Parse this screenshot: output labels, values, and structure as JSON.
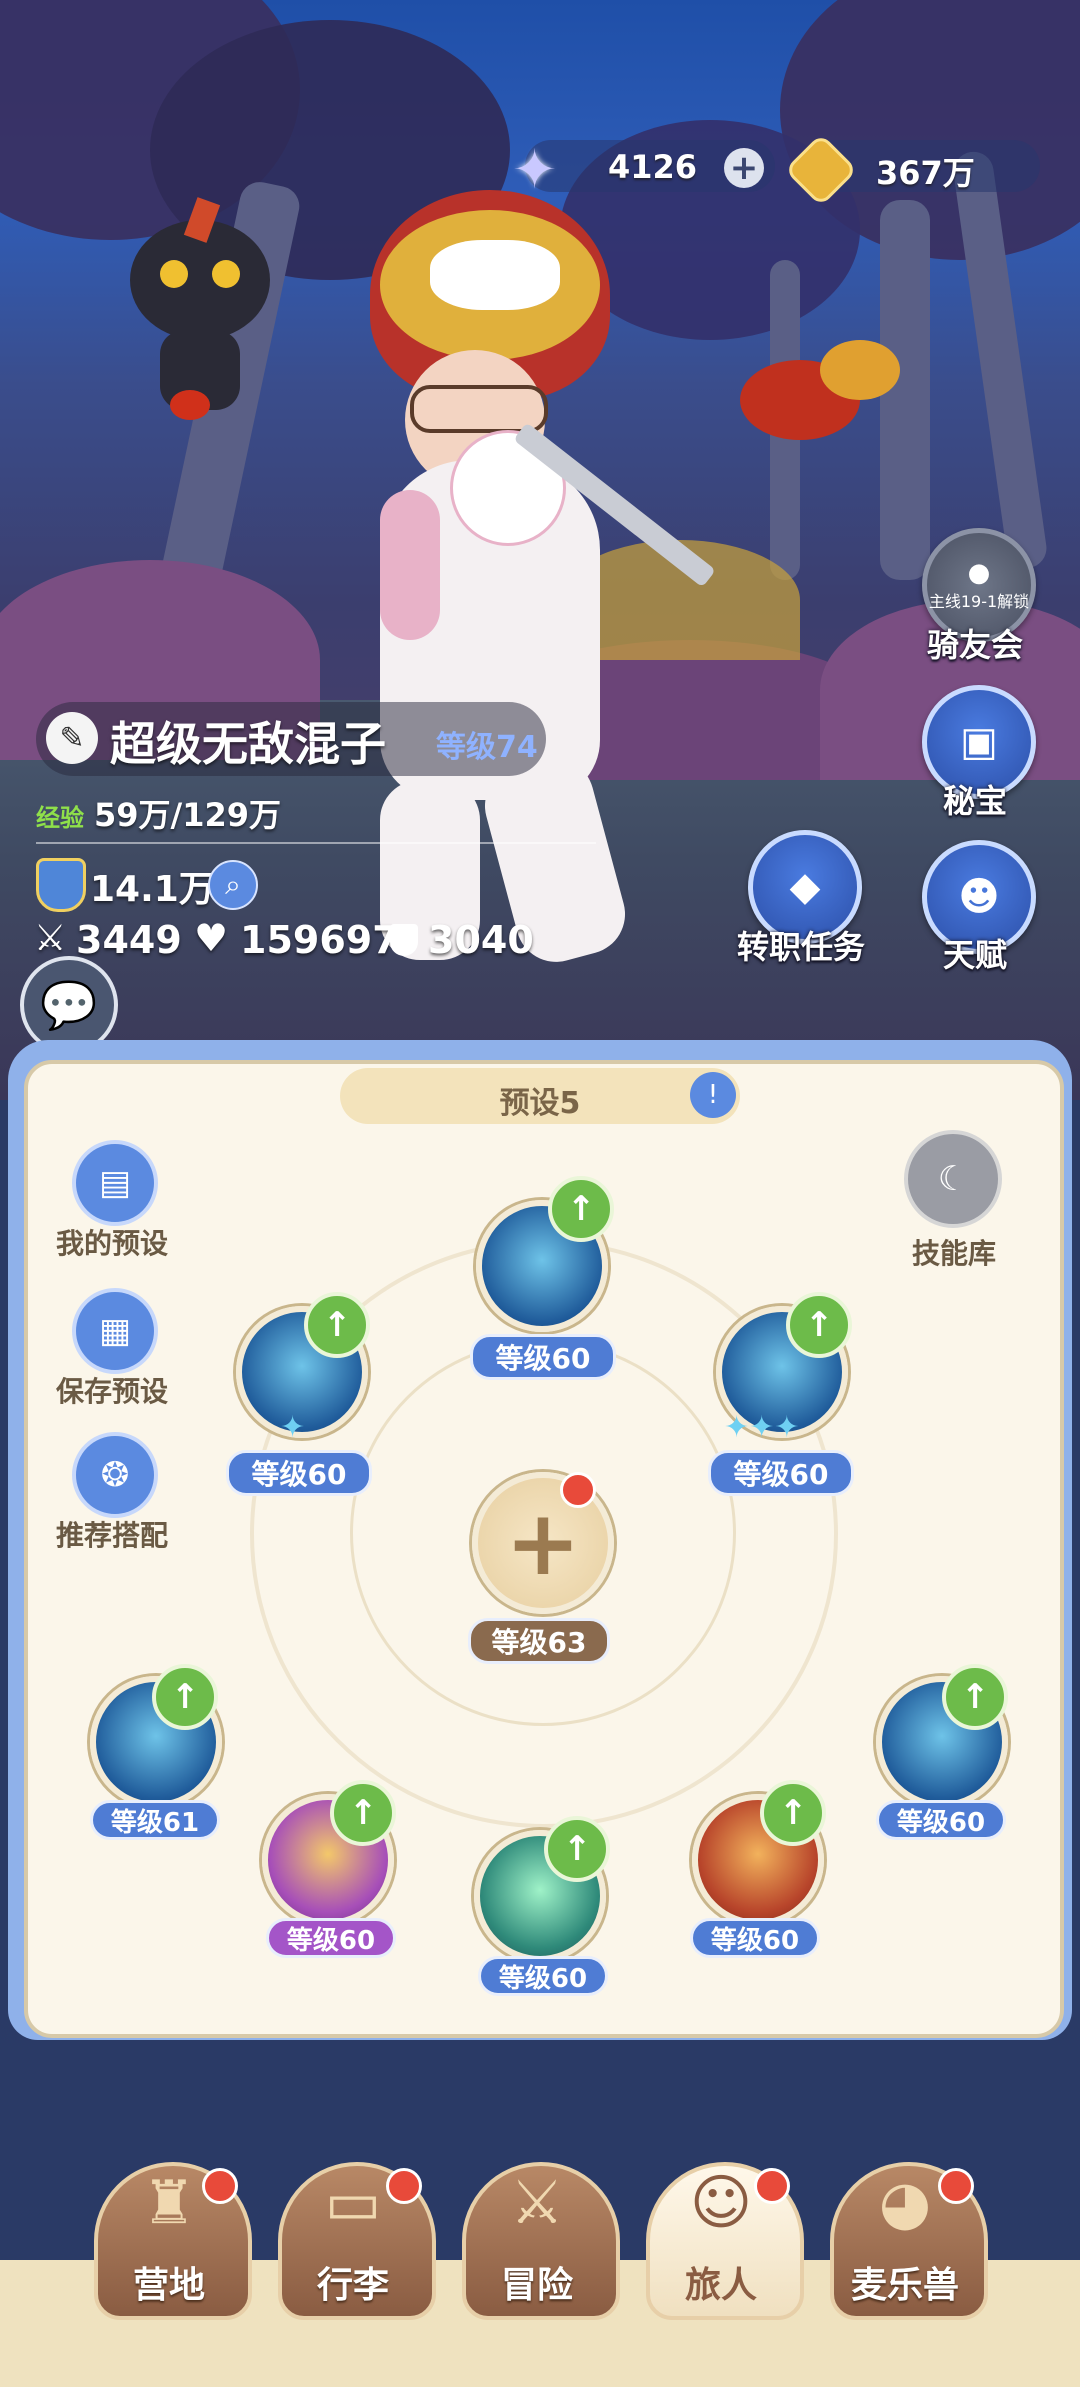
{
  "currency": {
    "crystal_amount": "4126",
    "gold_amount": "367万"
  },
  "right_menu": {
    "riding_club_lock_text": "主线19-1解锁",
    "riding_club_label": "骑友会",
    "treasure_label": "秘宝",
    "job_quest_label": "转职任务",
    "talent_label": "天赋"
  },
  "player": {
    "name": "超级无敌混子",
    "level": "等级74",
    "exp_label": "经验",
    "exp_value": "59万/129万",
    "power": "14.1万",
    "attack": "3449",
    "hp": "159697",
    "defense": "3040"
  },
  "panel": {
    "preset_title": "预设5",
    "my_presets": "我的预设",
    "save_preset": "保存预设",
    "recommended": "推荐搭配",
    "skill_library": "技能库",
    "center_level": "等级63",
    "skills": [
      {
        "level": "等级60"
      },
      {
        "level": "等级60"
      },
      {
        "level": "等级60"
      },
      {
        "level": "等级61"
      },
      {
        "level": "等级60"
      },
      {
        "level": "等级60"
      },
      {
        "level": "等级60"
      },
      {
        "level": "等级60"
      }
    ]
  },
  "nav": {
    "camp": "营地",
    "luggage": "行李",
    "adventure": "冒险",
    "traveler": "旅人",
    "pet": "麦乐兽"
  },
  "colors": {
    "accent_blue": "#4f7cd4",
    "upgrade_green": "#6dbb4a",
    "notification_red": "#e84a3a"
  }
}
